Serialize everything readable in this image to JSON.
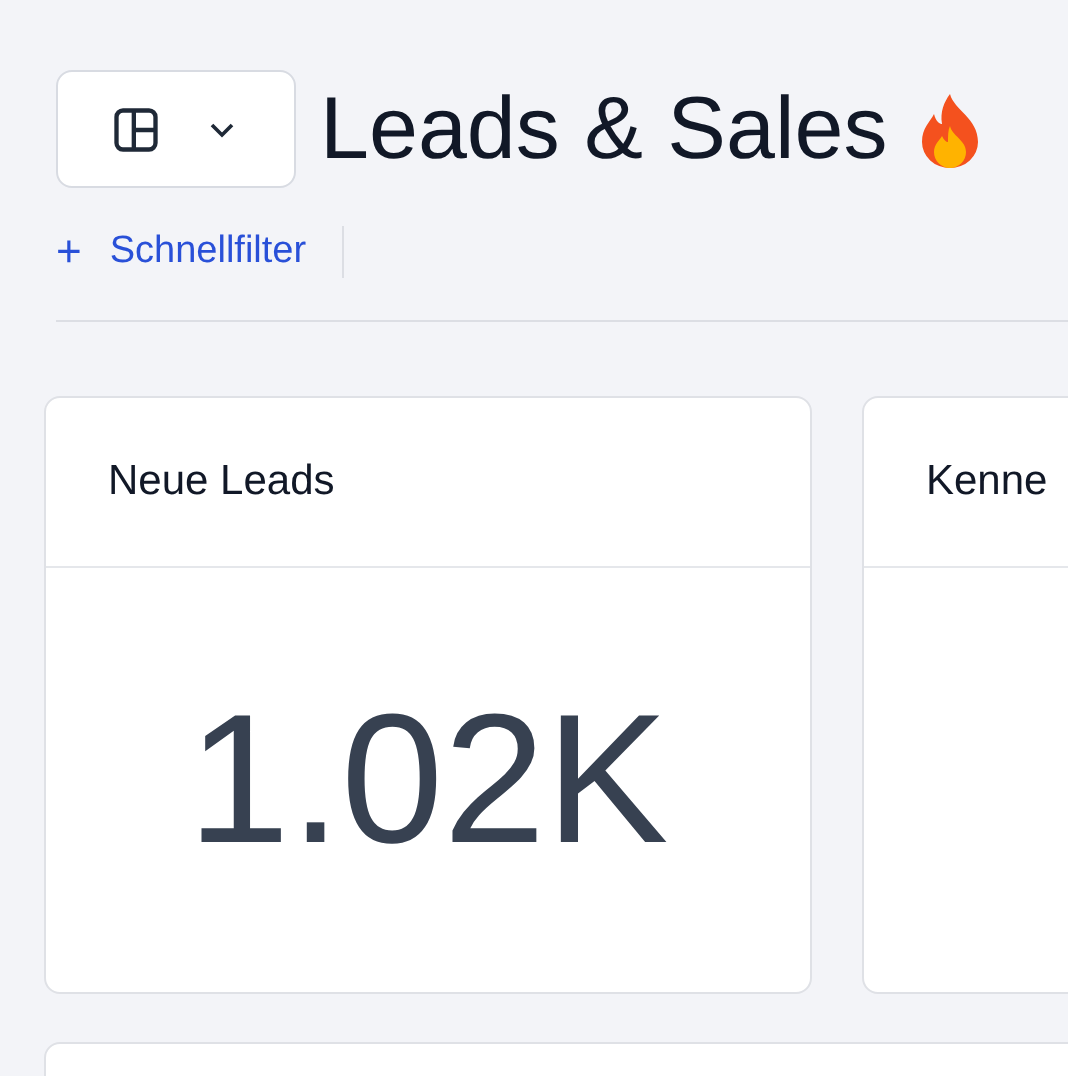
{
  "header": {
    "title": "Leads & Sales"
  },
  "filter_bar": {
    "add_filter": "Schnellfilter",
    "add_icon": "+"
  },
  "cards": [
    {
      "title": "Neue Leads",
      "value": "1.02K"
    },
    {
      "title": "Kenne"
    }
  ]
}
